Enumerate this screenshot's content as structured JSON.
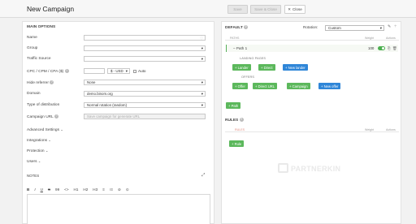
{
  "header": {
    "title": "New Campaign",
    "save_label": "Save",
    "save_close_label": "Save & Close",
    "close_label": "Close",
    "close_icon": "✕"
  },
  "main_options": {
    "section_title": "MAIN OPTIONS",
    "fields": {
      "name": {
        "label": "Name",
        "value": ""
      },
      "group": {
        "label": "Group",
        "value": ""
      },
      "traffic_source": {
        "label": "Traffic Source",
        "value": ""
      },
      "cost": {
        "label": "CPC / CPM / CPA ($)",
        "value": "",
        "currency": "$ - USD",
        "auto_label": "Auto"
      },
      "hide_referrer": {
        "label": "Hide referrer",
        "value": "None"
      },
      "domain": {
        "label": "Domain",
        "value": "demo.binom.org"
      },
      "distribution": {
        "label": "Type of distribution",
        "value": "Normal rotation (random)"
      },
      "campaign_url": {
        "label": "Campaign URL",
        "placeholder": "Save campaign for generate URL"
      }
    },
    "collapsibles": [
      "Advanced Settings",
      "Integrations",
      "Protection",
      "Users"
    ],
    "notes_label": "NOTES",
    "editor_tools": [
      "B",
      "I",
      "U",
      "S",
      "99",
      "<>",
      "H1",
      "H2",
      "H3",
      "≡",
      "⁝≡",
      "⊘",
      "⊙"
    ]
  },
  "default": {
    "section_title": "DEFAULT",
    "rotation_label": "Rotation:",
    "rotation_value": "Custom",
    "table_headers": {
      "paths": "PATHS",
      "weight": "Weight",
      "actions": "Actions"
    },
    "path": {
      "name": "Path 1",
      "weight": "100"
    },
    "landing_pages_label": "LANDING PAGES",
    "offers_label": "OFFERS",
    "landing_buttons": [
      "+ Lander",
      "+ Direct",
      "+ New lander"
    ],
    "offer_buttons": [
      "+ Offer",
      "+ Direct URL",
      "+ Campaign",
      "+ New offer"
    ],
    "add_path_label": "+ Path"
  },
  "rules": {
    "section_title": "RULES",
    "table_headers": {
      "rules": "RULES",
      "weight": "Weight",
      "actions": "Actions"
    },
    "add_rule_label": "+ Rule"
  },
  "watermark": "PARTNERKIN",
  "colors": {
    "accent_green": "#5cb85c",
    "accent_blue": "#2f86d8"
  }
}
